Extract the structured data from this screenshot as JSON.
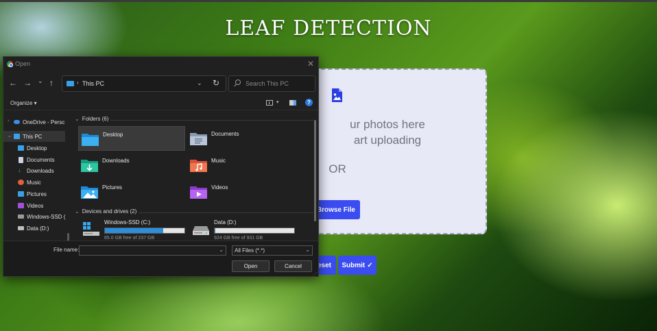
{
  "app": {
    "title": "LEAF DETECTION",
    "upload_line1": "ur photos here",
    "upload_line2": "art uploading",
    "or_text": "OR",
    "browse_label": "Browse File",
    "reset_label": "eset",
    "submit_label": "Submit",
    "submit_icon": "✓",
    "accent_color": "#3b4cf0"
  },
  "dialog": {
    "title": "Open",
    "close_glyph": "✕",
    "nav": {
      "back": "←",
      "forward": "→",
      "recent": "⌄",
      "up": "↑"
    },
    "address": {
      "chevron": "›",
      "location": "This PC",
      "dropdown": "⌄",
      "refresh": "↻"
    },
    "search_placeholder": "Search This PC",
    "organize_label": "Organize ▾",
    "view_dropdown": "▾",
    "help_glyph": "?",
    "sidebar": [
      {
        "label": "OneDrive - Persc",
        "arrow": "›",
        "icon": "cloud-icon"
      },
      {
        "label": "This PC",
        "arrow": "⌄",
        "icon": "pc-icon"
      },
      {
        "label": "Desktop",
        "icon": "desktop-icon"
      },
      {
        "label": "Documents",
        "icon": "documents-icon"
      },
      {
        "label": "Downloads",
        "icon": "downloads-icon"
      },
      {
        "label": "Music",
        "icon": "music-icon"
      },
      {
        "label": "Pictures",
        "icon": "pictures-icon"
      },
      {
        "label": "Videos",
        "icon": "videos-icon"
      },
      {
        "label": "Windows-SSD (",
        "icon": "ssd-icon"
      },
      {
        "label": "Data (D:)",
        "icon": "drive-icon"
      }
    ],
    "folders_header": "Folders (6)",
    "group_chevron": "⌄",
    "folders": [
      {
        "label": "Desktop",
        "icon": "desktop-folder-icon"
      },
      {
        "label": "Documents",
        "icon": "documents-folder-icon"
      },
      {
        "label": "Downloads",
        "icon": "downloads-folder-icon"
      },
      {
        "label": "Music",
        "icon": "music-folder-icon"
      },
      {
        "label": "Pictures",
        "icon": "pictures-folder-icon"
      },
      {
        "label": "Videos",
        "icon": "videos-folder-icon"
      }
    ],
    "drives_header": "Devices and drives (2)",
    "drives": [
      {
        "label": "Windows-SSD (C:)",
        "free": "65.0 GB free of 237 GB",
        "used_fraction": 0.73,
        "icon": "windows-drive-icon"
      },
      {
        "label": "Data (D:)",
        "free": "924 GB free of 931 GB",
        "used_fraction": 0.0075,
        "icon": "hdd-icon"
      }
    ],
    "filename_label": "File name:",
    "filename_value": "",
    "select_dropdown": "⌄",
    "filetype_value": "All Files (*.*)",
    "open_label": "Open",
    "cancel_label": "Cancel",
    "grip_glyph": "⋰"
  }
}
